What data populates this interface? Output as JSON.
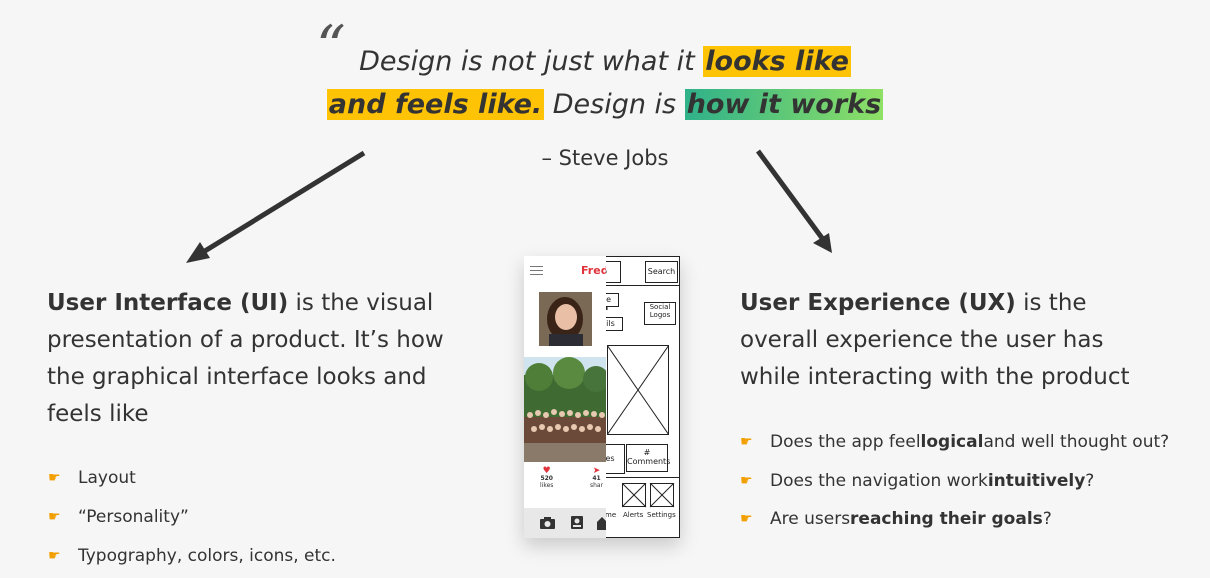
{
  "quote": {
    "part1": "Design is not just what it ",
    "hl1": "looks like",
    "hl2": "and feels like.",
    "part2": " Design is ",
    "hl3": "how it works",
    "author": "– Steve Jobs"
  },
  "ui": {
    "title": "User Interface (UI)",
    "desc": " is the visual presentation of a product. It’s how the graphical interface looks and feels like",
    "items": [
      "Layout",
      "“Personality”",
      "Typography, colors, icons, etc."
    ]
  },
  "ux": {
    "title": "User Experience (UX)",
    "desc": " is the overall experience the user has while interacting with the product",
    "q1": {
      "a": "Does the app feel ",
      "b": "logical",
      "c": " and well thought out?"
    },
    "q2": {
      "a": "Does the navigation work ",
      "b": "intuitively",
      "c": "?"
    },
    "q3": {
      "a": "Are users ",
      "b": "reaching their goals",
      "c": "?"
    }
  },
  "mockup": {
    "brand": "Fred",
    "wire_logo": "go",
    "search": "Search",
    "wire_name": "Sa",
    "wire_sub1": "Sa",
    "wire_sub2": "Ph",
    "wire_label_ne": "ne",
    "wire_label_ails": "ails",
    "social": "Social Logos",
    "label_es": "es",
    "comments": "# Comments",
    "likes_count": "520",
    "likes_label": "likes",
    "shares_count": "41",
    "shares_label": "shar",
    "nav_me": "me",
    "nav_alerts": "Alerts",
    "nav_settings": "Settings"
  },
  "colors": {
    "highlight_yellow": "#fec304",
    "highlight_green_start": "#2fb18a",
    "highlight_green_end": "#8fe066",
    "brand_red": "#e0333b",
    "twitter_blue": "#1da1f2"
  },
  "icons": [
    "quote-open-icon",
    "arrow-down-left-icon",
    "arrow-down-right-icon",
    "pointing-hand-icon",
    "hamburger-icon",
    "twitter-icon",
    "heart-icon",
    "send-icon",
    "camera-icon",
    "contact-icon",
    "home-icon"
  ]
}
